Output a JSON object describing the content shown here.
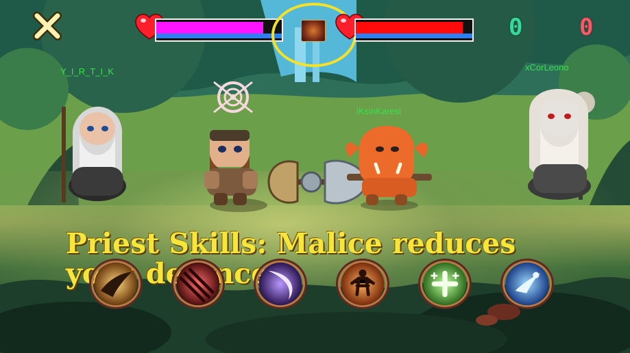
{
  "hud": {
    "left_health": 0.85,
    "right_health": 0.92,
    "left_health_color": "#ff14ff",
    "right_health_color": "#ff0b0b",
    "score_left": "0",
    "score_right": "0"
  },
  "players": {
    "left_wizard": "Y_I_R_T_I_K",
    "right_wizard": "xCorLeono",
    "orc": "iKsinKaresi"
  },
  "banner": {
    "text": "Priest Skills: Malice reduces your defence"
  },
  "skills": [
    {
      "icon": "dash-icon"
    },
    {
      "icon": "claw-slash-icon"
    },
    {
      "icon": "crescent-slash-icon"
    },
    {
      "icon": "power-stance-icon"
    },
    {
      "icon": "healing-cross-icon"
    },
    {
      "icon": "blink-icon"
    }
  ],
  "colors": {
    "accent_yellow": "#f4e12a",
    "team_green": "#38e14a",
    "score_green": "#3bd79a",
    "score_red": "#f25a66"
  }
}
